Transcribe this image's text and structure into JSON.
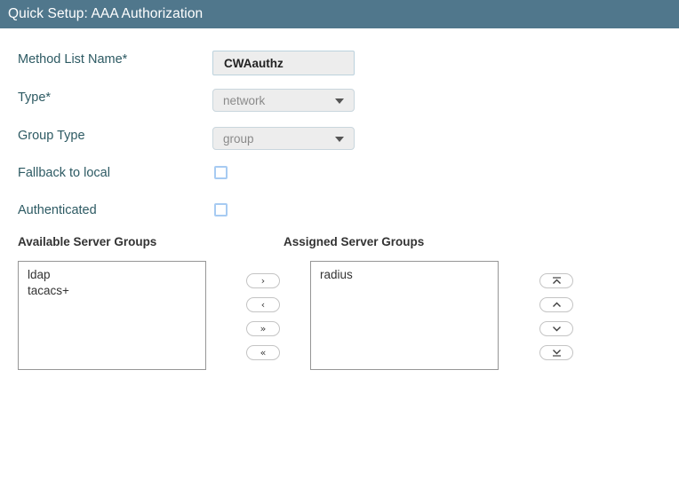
{
  "window": {
    "title": "Quick Setup: AAA Authorization",
    "header_color": "#50778c"
  },
  "form": {
    "fields": [
      {
        "label": "Method List Name*",
        "value": "CWAauthz",
        "placeholder": "",
        "control": "text"
      },
      {
        "label": "Type*",
        "value": "network",
        "control": "select"
      },
      {
        "label": "Group Type",
        "value": "group",
        "control": "select"
      },
      {
        "label": "Fallback to local",
        "value": "",
        "control": "checkbox",
        "checked": false
      },
      {
        "label": "Authenticated",
        "value": "",
        "control": "checkbox",
        "checked": false
      }
    ]
  },
  "dual_list": {
    "available": {
      "heading": "Available Server Groups",
      "items": [
        "ldap",
        "tacacs+"
      ]
    },
    "assigned": {
      "heading": "Assigned Server Groups",
      "items": [
        "radius"
      ]
    },
    "transfer_buttons": [
      {
        "name": "move-right-button",
        "glyph": "›",
        "title": "Move selected right"
      },
      {
        "name": "move-left-button",
        "glyph": "‹",
        "title": "Move selected left"
      },
      {
        "name": "move-all-right-button",
        "glyph": "»",
        "title": "Move all right"
      },
      {
        "name": "move-all-left-button",
        "glyph": "«",
        "title": "Move all left"
      }
    ],
    "order_buttons": [
      {
        "name": "move-to-top-button",
        "icon": "caret-up-bar-icon",
        "title": "Move to top"
      },
      {
        "name": "move-up-button",
        "icon": "caret-up-icon",
        "title": "Move up"
      },
      {
        "name": "move-down-button",
        "icon": "caret-down-icon",
        "title": "Move down"
      },
      {
        "name": "move-to-bottom-button",
        "icon": "caret-down-bar-icon",
        "title": "Move to bottom"
      }
    ]
  },
  "colors": {
    "label_text": "#2d5a63",
    "input_background": "#ededed",
    "checkbox_border": "#a7cbf2",
    "listbox_border": "#969696"
  }
}
